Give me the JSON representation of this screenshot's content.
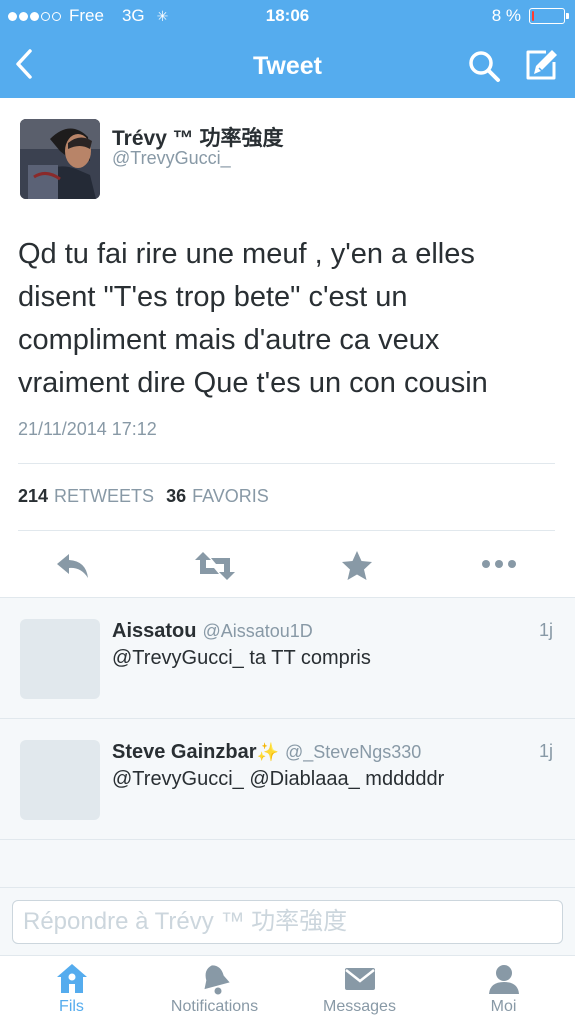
{
  "statusbar": {
    "carrier": "Free",
    "network": "3G",
    "time": "18:06",
    "battery_text": "8 %",
    "battery_level": 0.08
  },
  "navbar": {
    "title": "Tweet",
    "back_icon": "chevron-left-icon",
    "search_icon": "search-icon",
    "compose_icon": "compose-icon"
  },
  "tweet": {
    "author_name": "Trévy ™ 功率強度",
    "author_handle": "@TrevyGucci_",
    "text": "Qd tu fai rire une meuf , y'en a elles disent \"T'es trop bete\" c'est un compliment mais d'autre ca veux vraiment dire Que t'es un con cousin",
    "date": "21/11/2014 17:12",
    "retweet_count": "214",
    "retweet_label": "RETWEETS",
    "favorite_count": "36",
    "favorite_label": "FAVORIS"
  },
  "replies": [
    {
      "name": "Aissatou",
      "handle": "@Aissatou1D",
      "time": "1j",
      "text": "@TrevyGucci_ ta TT compris"
    },
    {
      "name": "Steve Gainzbar",
      "name_emoji": "✨",
      "handle": "@_SteveNgs330",
      "time": "1j",
      "text": "@TrevyGucci_ @Diablaaa_ mdddddr"
    }
  ],
  "reply_bar": {
    "placeholder": "Répondre à Trévy ™ 功率強度"
  },
  "tabbar": {
    "tabs": [
      {
        "label": "Fils",
        "icon": "home-icon",
        "active": true
      },
      {
        "label": "Notifications",
        "icon": "bell-icon",
        "active": false
      },
      {
        "label": "Messages",
        "icon": "envelope-icon",
        "active": false
      },
      {
        "label": "Moi",
        "icon": "person-icon",
        "active": false
      }
    ]
  },
  "colors": {
    "brand": "#55acee",
    "text": "#292f33",
    "muted": "#8899a6",
    "battery_low": "#ff3b30"
  }
}
